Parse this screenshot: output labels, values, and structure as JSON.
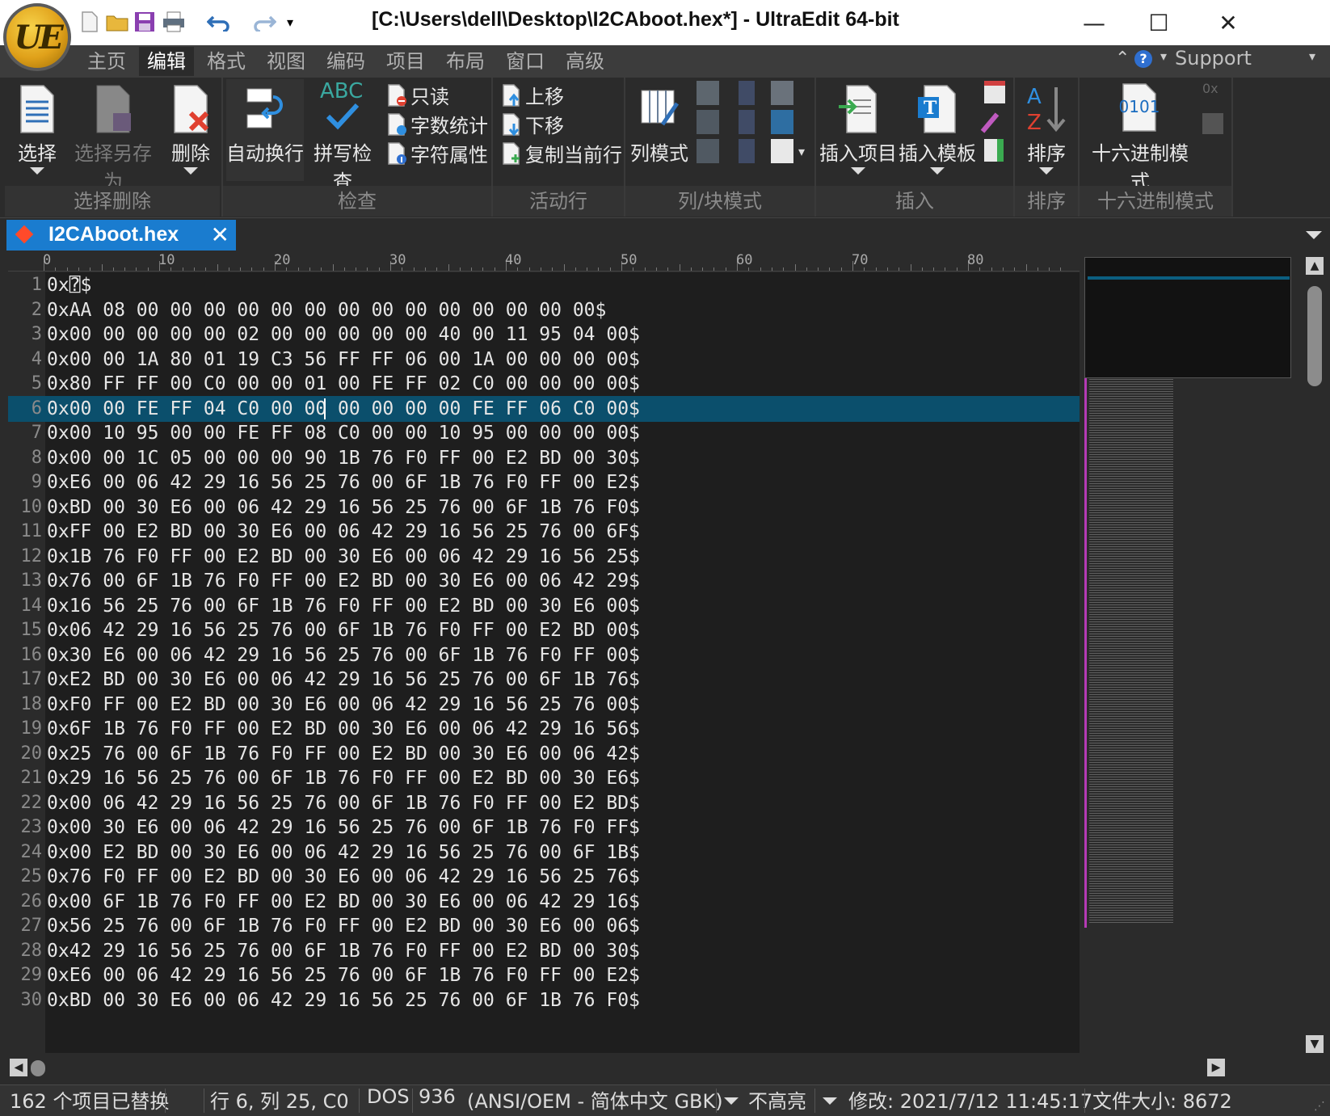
{
  "window": {
    "title": "[C:\\Users\\dell\\Desktop\\I2CAboot.hex*] - UltraEdit 64-bit",
    "logo_text": "UE",
    "minimize": "—",
    "maximize": "☐",
    "close": "✕"
  },
  "menu": {
    "tabs": [
      "主页",
      "编辑",
      "格式",
      "视图",
      "编码",
      "项目",
      "布局",
      "窗口",
      "高级"
    ],
    "active_index": 1,
    "support_label": "Support"
  },
  "ribbon": {
    "groups": {
      "select_delete": {
        "label": "选择删除",
        "select": "选择",
        "select_save_as": "选择另存为",
        "delete": "删除"
      },
      "check": {
        "label": "检查",
        "word_wrap": "自动换行",
        "spell_check": "拼写检查",
        "spell_icon_text": "ABC",
        "read_only": "只读",
        "word_count": "字数统计",
        "char_props": "字符属性"
      },
      "active_line": {
        "label": "活动行",
        "move_up": "上移",
        "move_down": "下移",
        "duplicate_line": "复制当前行"
      },
      "column_mode": {
        "label": "列/块模式",
        "column_mode": "列模式"
      },
      "insert": {
        "label": "插入",
        "insert_item": "插入项目",
        "insert_template": "插入模板"
      },
      "sort": {
        "label": "排序",
        "sort": "排序"
      },
      "hex_mode": {
        "label": "十六进制模式",
        "hex_mode": "十六进制模式",
        "hex_icon_text": "0101"
      }
    }
  },
  "document": {
    "tab_name": "I2CAboot.hex",
    "tab_close": "✕",
    "modified": true,
    "ruler_numbers": [
      "0",
      "10",
      "20",
      "30",
      "40",
      "50",
      "60",
      "70",
      "80"
    ],
    "current_line": 6,
    "current_column": 25,
    "lines": [
      "0x⍰$",
      "0xAA 08 00 00 00 00 00 00 00 00 00 00 00 00 00 00$",
      "0x00 00 00 00 00 02 00 00 00 00 00 40 00 11 95 04 00$",
      "0x00 00 1A 80 01 19 C3 56 FF FF 06 00 1A 00 00 00 00$",
      "0x80 FF FF 00 C0 00 00 01 00 FE FF 02 C0 00 00 00 00$",
      "0x00 00 FE FF 04 C0 00 00 00 00 00 00 FE FF 06 C0 00$",
      "0x00 10 95 00 00 FE FF 08 C0 00 00 10 95 00 00 00 00$",
      "0x00 00 1C 05 00 00 00 90 1B 76 F0 FF 00 E2 BD 00 30$",
      "0xE6 00 06 42 29 16 56 25 76 00 6F 1B 76 F0 FF 00 E2$",
      "0xBD 00 30 E6 00 06 42 29 16 56 25 76 00 6F 1B 76 F0$",
      "0xFF 00 E2 BD 00 30 E6 00 06 42 29 16 56 25 76 00 6F$",
      "0x1B 76 F0 FF 00 E2 BD 00 30 E6 00 06 42 29 16 56 25$",
      "0x76 00 6F 1B 76 F0 FF 00 E2 BD 00 30 E6 00 06 42 29$",
      "0x16 56 25 76 00 6F 1B 76 F0 FF 00 E2 BD 00 30 E6 00$",
      "0x06 42 29 16 56 25 76 00 6F 1B 76 F0 FF 00 E2 BD 00$",
      "0x30 E6 00 06 42 29 16 56 25 76 00 6F 1B 76 F0 FF 00$",
      "0xE2 BD 00 30 E6 00 06 42 29 16 56 25 76 00 6F 1B 76$",
      "0xF0 FF 00 E2 BD 00 30 E6 00 06 42 29 16 56 25 76 00$",
      "0x6F 1B 76 F0 FF 00 E2 BD 00 30 E6 00 06 42 29 16 56$",
      "0x25 76 00 6F 1B 76 F0 FF 00 E2 BD 00 30 E6 00 06 42$",
      "0x29 16 56 25 76 00 6F 1B 76 F0 FF 00 E2 BD 00 30 E6$",
      "0x00 06 42 29 16 56 25 76 00 6F 1B 76 F0 FF 00 E2 BD$",
      "0x00 30 E6 00 06 42 29 16 56 25 76 00 6F 1B 76 F0 FF$",
      "0x00 E2 BD 00 30 E6 00 06 42 29 16 56 25 76 00 6F 1B$",
      "0x76 F0 FF 00 E2 BD 00 30 E6 00 06 42 29 16 56 25 76$",
      "0x00 6F 1B 76 F0 FF 00 E2 BD 00 30 E6 00 06 42 29 16$",
      "0x56 25 76 00 6F 1B 76 F0 FF 00 E2 BD 00 30 E6 00 06$",
      "0x42 29 16 56 25 76 00 6F 1B 76 F0 FF 00 E2 BD 00 30$",
      "0xE6 00 06 42 29 16 56 25 76 00 6F 1B 76 F0 FF 00 E2$",
      "0xBD 00 30 E6 00 06 42 29 16 56 25 76 00 6F 1B 76 F0$"
    ]
  },
  "status": {
    "replaced": "162 个项目已替换",
    "position": "行 6, 列 25, C0",
    "line_ending": "DOS",
    "codepage": "936",
    "encoding": "(ANSI/OEM - 简体中文 GBK)",
    "highlight": "不高亮",
    "modified": "修改:   2021/7/12 11:45:17",
    "file_size": "文件大小:   8672"
  },
  "colors": {
    "accent_tab": "#1a7ccf",
    "current_line": "#0b4f6c",
    "editor_bg": "#1e1e1e",
    "chrome_bg": "#2b2b2b"
  },
  "icons": {
    "quick_access": [
      "new-file-icon",
      "open-folder-icon",
      "save-icon",
      "print-icon",
      "undo-icon",
      "redo-icon",
      "customize-dropdown-icon"
    ],
    "help": "help-icon"
  }
}
